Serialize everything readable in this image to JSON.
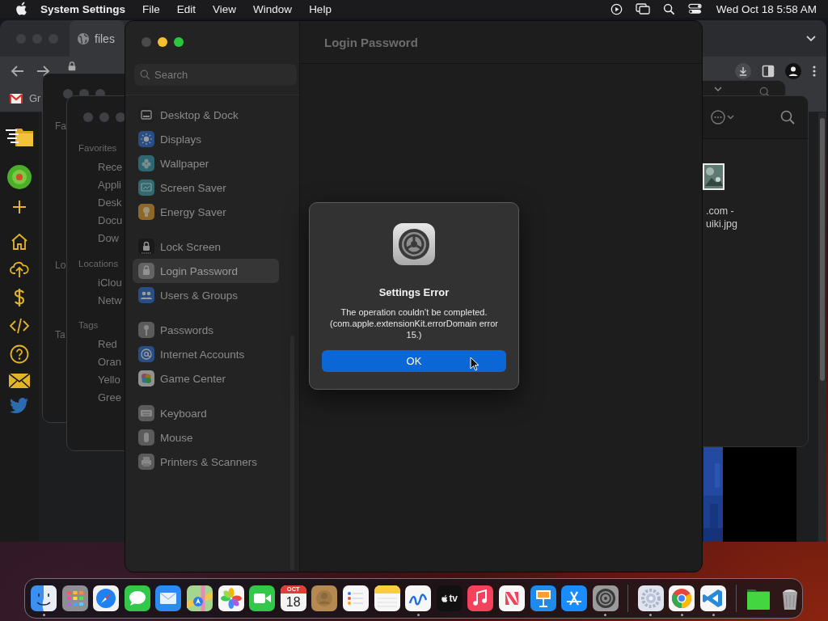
{
  "menu_bar": {
    "app_name": "System Settings",
    "menus": [
      "File",
      "Edit",
      "View",
      "Window",
      "Help"
    ],
    "clock": "Wed Oct 18  5:58 AM"
  },
  "browser_window": {
    "tab_title": "files",
    "bookmark": "Gr"
  },
  "finder_windows": [
    {
      "sections": [
        {
          "title": "Fa"
        },
        {
          "title": "Lo"
        },
        {
          "title": "Ta"
        }
      ]
    },
    {
      "sections": [
        {
          "title": "Favorites",
          "items": [
            "Rece",
            "Appli",
            "Desk",
            "Docu",
            "Dow"
          ]
        },
        {
          "title": "Locations",
          "items": [
            "iClou",
            "Netw"
          ]
        },
        {
          "title": "Tags",
          "items": [
            "Red",
            "Oran",
            "Yello",
            "Gree"
          ]
        }
      ]
    }
  ],
  "file_window": {
    "file_name_lines": [
      ".com -",
      "uiki.jpg"
    ]
  },
  "settings": {
    "search": {
      "placeholder": "Search"
    },
    "page_title": "Login Password",
    "sidebar": {
      "groups": [
        {
          "items": [
            {
              "label": "Desktop & Dock",
              "kind": "dock",
              "selected": false
            },
            {
              "label": "Displays",
              "kind": "displays",
              "selected": false
            },
            {
              "label": "Wallpaper",
              "kind": "wallpaper",
              "selected": false
            },
            {
              "label": "Screen Saver",
              "kind": "screensaver",
              "selected": false
            },
            {
              "label": "Energy Saver",
              "kind": "energy",
              "selected": false
            }
          ]
        },
        {
          "items": [
            {
              "label": "Lock Screen",
              "kind": "lock",
              "selected": false
            },
            {
              "label": "Login Password",
              "kind": "login",
              "selected": true
            },
            {
              "label": "Users & Groups",
              "kind": "users",
              "selected": false
            }
          ]
        },
        {
          "items": [
            {
              "label": "Passwords",
              "kind": "passwords",
              "selected": false
            },
            {
              "label": "Internet Accounts",
              "kind": "internet",
              "selected": false
            },
            {
              "label": "Game Center",
              "kind": "gamecenter",
              "selected": false
            }
          ]
        },
        {
          "items": [
            {
              "label": "Keyboard",
              "kind": "keyboard",
              "selected": false
            },
            {
              "label": "Mouse",
              "kind": "mouse",
              "selected": false
            },
            {
              "label": "Printers & Scanners",
              "kind": "printers",
              "selected": false
            }
          ]
        }
      ]
    }
  },
  "dialog": {
    "title": "Settings Error",
    "message": "The operation couldn’t be completed. (com.apple.extensionKit.errorDomain error 15.)",
    "button": "OK"
  },
  "dock": {
    "items": [
      {
        "kind": "finder",
        "running": true
      },
      {
        "kind": "launchpad",
        "running": false
      },
      {
        "kind": "safari",
        "running": false
      },
      {
        "kind": "messages",
        "running": false
      },
      {
        "kind": "mail",
        "running": false
      },
      {
        "kind": "maps",
        "running": false
      },
      {
        "kind": "photos",
        "running": false
      },
      {
        "kind": "facetime",
        "running": false
      },
      {
        "kind": "calendar",
        "running": false,
        "month": "OCT",
        "day": "18"
      },
      {
        "kind": "contacts",
        "running": false
      },
      {
        "kind": "reminders",
        "running": false
      },
      {
        "kind": "notes",
        "running": false
      },
      {
        "kind": "freeform",
        "running": true
      },
      {
        "kind": "tv",
        "running": false,
        "label": "tv"
      },
      {
        "kind": "music",
        "running": false
      },
      {
        "kind": "news",
        "running": false
      },
      {
        "kind": "keynote",
        "running": false
      },
      {
        "kind": "appstore",
        "running": false
      },
      {
        "kind": "settings",
        "running": true
      },
      {
        "kind": "separator"
      },
      {
        "kind": "gearapp",
        "running": true
      },
      {
        "kind": "chrome",
        "running": true
      },
      {
        "kind": "vscode",
        "running": true
      },
      {
        "kind": "separator"
      },
      {
        "kind": "folder",
        "running": false
      },
      {
        "kind": "trash",
        "running": false
      }
    ]
  }
}
